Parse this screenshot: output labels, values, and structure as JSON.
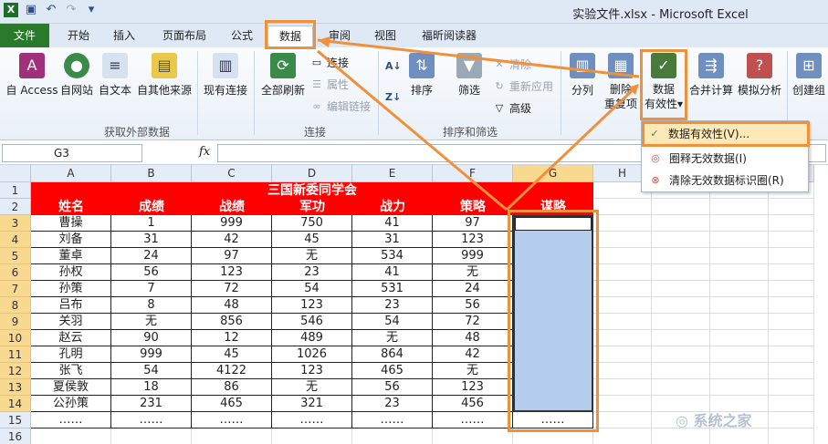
{
  "window": {
    "title": "实验文件.xlsx  -  Microsoft Excel"
  },
  "tabs": [
    {
      "id": "file",
      "label": "文件"
    },
    {
      "id": "home",
      "label": "开始"
    },
    {
      "id": "insert",
      "label": "插入"
    },
    {
      "id": "layout",
      "label": "页面布局"
    },
    {
      "id": "formula",
      "label": "公式"
    },
    {
      "id": "data",
      "label": "数据"
    },
    {
      "id": "review",
      "label": "审阅"
    },
    {
      "id": "view",
      "label": "视图"
    },
    {
      "id": "foxit",
      "label": "福昕阅读器"
    }
  ],
  "ribbon": {
    "ext_group": "获取外部数据",
    "conn_group": "连接",
    "sort_group": "排序和筛选",
    "access": "自 Access",
    "web": "自网站",
    "text": "自文本",
    "other": "自其他来源",
    "existing": "现有连接",
    "refresh": "全部刷新",
    "connections": "连接",
    "properties": "属性",
    "edit_links": "编辑链接",
    "sort": "排序",
    "filter": "筛选",
    "clear": "清除",
    "reapply": "重新应用",
    "advanced": "高级",
    "split": "分列",
    "remove_dup_1": "删除",
    "remove_dup_2": "重复项",
    "dv_1": "数据",
    "dv_2": "有效性",
    "consolidate": "合并计算",
    "whatif": "模拟分析",
    "group": "创建组"
  },
  "dropdown": {
    "items": [
      "数据有效性(V)...",
      "圈释无效数据(I)",
      "清除无效数据标识圈(R)"
    ]
  },
  "formula_bar": {
    "name_box": "G3",
    "fx": "fx"
  },
  "sheet": {
    "columns": [
      "A",
      "B",
      "C",
      "D",
      "E",
      "F",
      "G",
      "H",
      "I",
      "J",
      "K"
    ],
    "row_numbers": [
      "1",
      "2",
      "3",
      "4",
      "5",
      "6",
      "7",
      "8",
      "9",
      "10",
      "11",
      "12",
      "13",
      "14",
      "15",
      "16"
    ],
    "title": "三国新委同学会",
    "headers": [
      "姓名",
      "成绩",
      "战绩",
      "军功",
      "战力",
      "策略",
      "谋略"
    ],
    "rows": [
      [
        "曹操",
        "1",
        "999",
        "750",
        "41",
        "97"
      ],
      [
        "刘备",
        "31",
        "42",
        "45",
        "31",
        "123"
      ],
      [
        "董卓",
        "24",
        "97",
        "无",
        "534",
        "999"
      ],
      [
        "孙权",
        "56",
        "123",
        "23",
        "41",
        "无"
      ],
      [
        "孙策",
        "7",
        "72",
        "54",
        "531",
        "24"
      ],
      [
        "吕布",
        "8",
        "48",
        "123",
        "23",
        "56"
      ],
      [
        "关羽",
        "无",
        "856",
        "546",
        "54",
        "72"
      ],
      [
        "赵云",
        "90",
        "12",
        "489",
        "无",
        "48"
      ],
      [
        "孔明",
        "999",
        "45",
        "1026",
        "864",
        "42"
      ],
      [
        "张飞",
        "54",
        "4122",
        "123",
        "465",
        "无"
      ],
      [
        "夏侯敦",
        "18",
        "86",
        "无",
        "56",
        "123"
      ],
      [
        "公孙策",
        "231",
        "465",
        "321",
        "23",
        "456"
      ],
      [
        "……",
        "……",
        "……",
        "……",
        "……",
        "……",
        "……"
      ]
    ]
  },
  "colors": {
    "accent": "#f0903a",
    "header_red": "#ff0000",
    "selection": "#b4cdee"
  }
}
